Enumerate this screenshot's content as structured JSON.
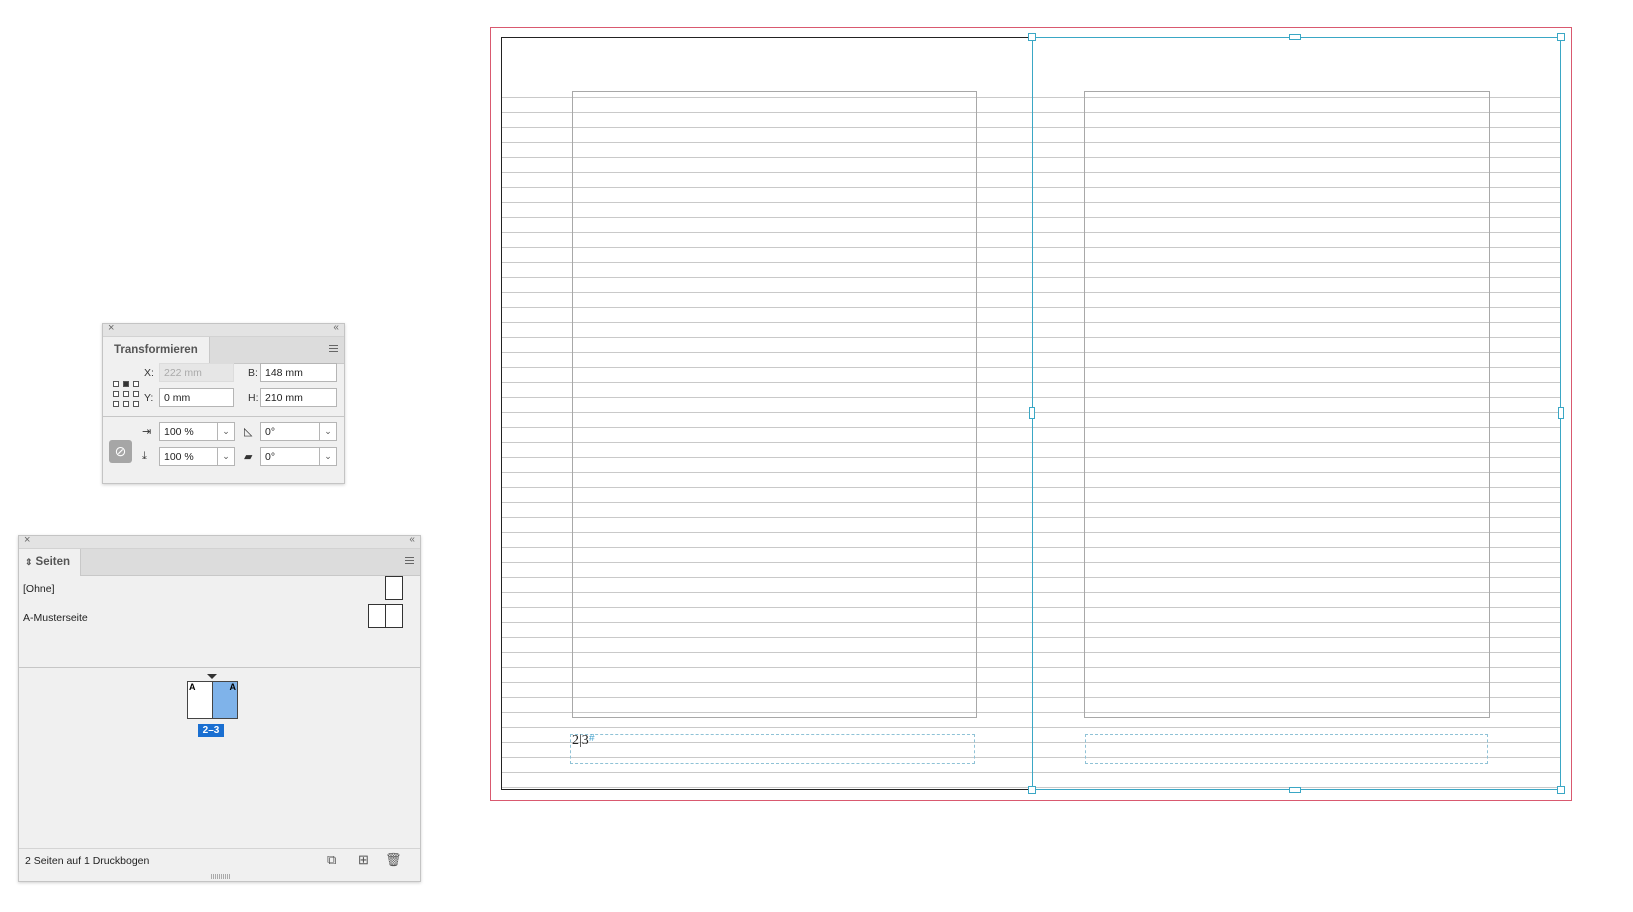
{
  "transform_panel": {
    "tab_label": "Transformieren",
    "x_label": "X:",
    "x_value": "222 mm",
    "y_label": "Y:",
    "y_value": "0 mm",
    "w_label": "B:",
    "w_value": "148 mm",
    "h_label": "H:",
    "h_value": "210 mm",
    "scale_x_value": "100 %",
    "scale_y_value": "100 %",
    "rotation_value": "0°",
    "shear_value": "0°"
  },
  "pages_panel": {
    "tab_label": "Seiten",
    "masters": [
      {
        "label": "[Ohne]"
      },
      {
        "label": "A-Musterseite"
      }
    ],
    "spread_master_left": "A",
    "spread_master_right": "A",
    "spread_label": "2–3",
    "footer_text": "2 Seiten auf 1 Druckbogen"
  },
  "document": {
    "page_number_text": "2|3"
  },
  "colors": {
    "bleed": "#d9596f",
    "selection": "#3aa7c5",
    "active_page": "#7fb3ea",
    "spread_badge": "#1a6fd1"
  }
}
